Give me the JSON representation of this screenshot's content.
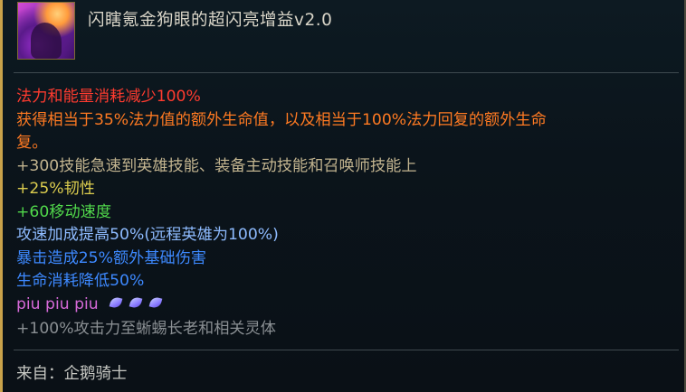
{
  "item": {
    "title": "闪瞎氪金狗眼的超闪亮增益v2.0",
    "icon": "augment-icon"
  },
  "stats": [
    {
      "text": "法力和能量消耗减少100%",
      "color": "#ff3b2f"
    },
    {
      "text": "获得相当于35%法力值的额外生命值，以及相当于100%法力回复的额外生命",
      "color": "#ff7a22"
    },
    {
      "text": "复。",
      "color": "#ff7a22"
    },
    {
      "text": "+300技能急速到英雄技能、装备主动技能和召唤师技能上",
      "color": "#c2b48f"
    },
    {
      "text": "+25%韧性",
      "color": "#dccd4e"
    },
    {
      "text": "+60移动速度",
      "color": "#51d84b"
    },
    {
      "text": "攻速加成提高50%(远程英雄为100%)",
      "color": "#8ebbff"
    },
    {
      "text": "暴击造成25%额外基础伤害",
      "color": "#3d89ff"
    },
    {
      "text": "生命消耗降低50%",
      "color": "#3d89ff"
    },
    {
      "text": "piu piu piu",
      "color": "#d66ad8",
      "icons": [
        "feather-icon",
        "feather-icon",
        "feather-icon"
      ]
    },
    {
      "text": "+100%攻击力至蜥蜴长老和相关灵体",
      "color": "#8a8f93"
    }
  ],
  "footer": {
    "source": "来自：企鹅骑士"
  }
}
